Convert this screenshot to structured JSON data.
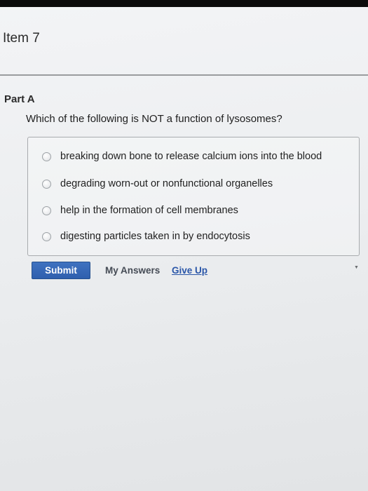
{
  "item": {
    "title": "Item 7"
  },
  "part": {
    "label": "Part A",
    "question": "Which of the following is NOT a function of lysosomes?"
  },
  "options": [
    {
      "label": "breaking down bone to release calcium ions into the blood",
      "selected": false
    },
    {
      "label": "degrading worn-out or nonfunctional organelles",
      "selected": false
    },
    {
      "label": "help in the formation of cell membranes",
      "selected": false
    },
    {
      "label": "digesting particles taken in by endocytosis",
      "selected": false
    }
  ],
  "actions": {
    "submit_label": "Submit",
    "my_answers_label": "My Answers",
    "give_up_label": "Give Up"
  },
  "colors": {
    "accent": "#3366b3",
    "link": "#2a56a8"
  }
}
